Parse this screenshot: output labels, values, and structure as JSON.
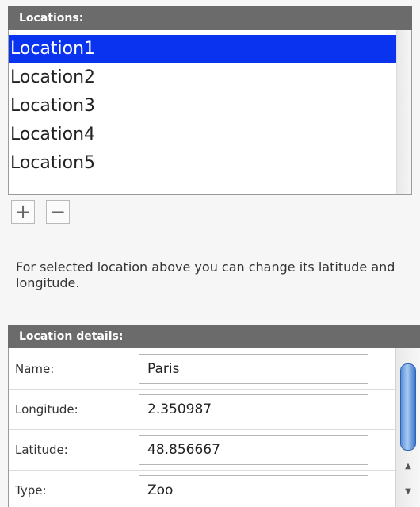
{
  "locations": {
    "header": "Locations:",
    "items": [
      {
        "label": "Location1",
        "selected": true
      },
      {
        "label": "Location2",
        "selected": false
      },
      {
        "label": "Location3",
        "selected": false
      },
      {
        "label": "Location4",
        "selected": false
      },
      {
        "label": "Location5",
        "selected": false
      }
    ],
    "add_label": "+",
    "remove_label": "−"
  },
  "help_text": "For selected location above you can change its latitude and longitude.",
  "details": {
    "header": "Location details:",
    "fields": [
      {
        "label": "Name:",
        "value": "Paris"
      },
      {
        "label": "Longitude:",
        "value": "2.350987"
      },
      {
        "label": "Latitude:",
        "value": "48.856667"
      },
      {
        "label": "Type:",
        "value": "Zoo"
      }
    ],
    "scroll_up_glyph": "▲",
    "scroll_down_glyph": "▼"
  },
  "colors": {
    "header_bg": "#6b6b6b",
    "selection": "#0a33f0",
    "scroll_thumb": "#5a8fd8"
  }
}
